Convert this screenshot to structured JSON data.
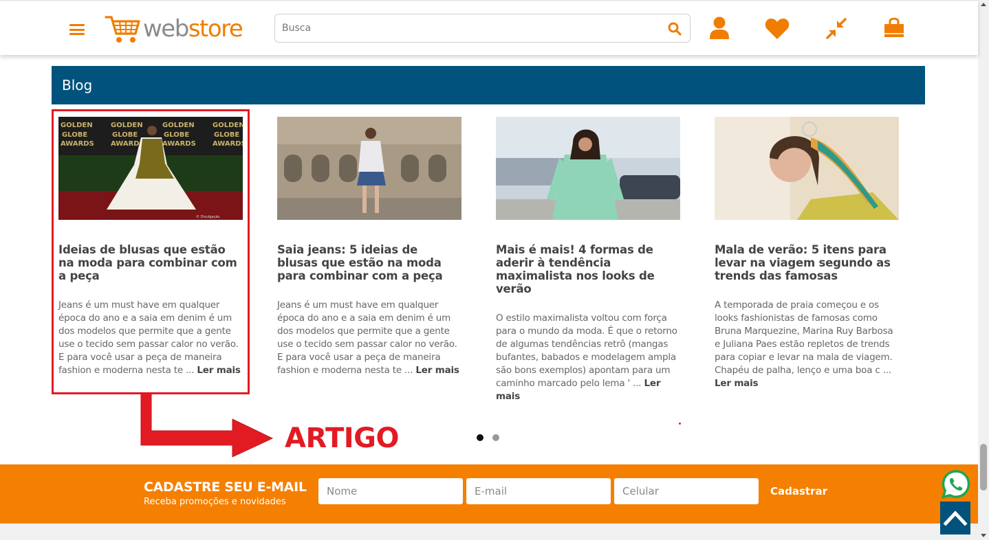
{
  "header": {
    "logo_text_left": "web",
    "logo_text_right": "store",
    "search_placeholder": "Busca",
    "icons": [
      "menu-icon",
      "search-icon",
      "user-icon",
      "heart-icon",
      "compare-icon",
      "shopping-bag-icon"
    ]
  },
  "blog": {
    "title": "Blog",
    "read_more_label": "Ler mais",
    "cards": [
      {
        "title": "Ideias de blusas que estão na moda para combinar com a peça",
        "excerpt": "Jeans é um must have em qualquer época do ano e a saia em denim é um dos modelos que permite que a gente use o tecido sem passar calor no verão. E para você usar a peça de maneira fashion e moderna nesta te ...",
        "image_text": "GOLDEN GLOBE AWARDS"
      },
      {
        "title": "Saia jeans: 5 ideias de blusas que estão na moda para combinar com a peça",
        "excerpt": "Jeans é um must have em qualquer época do ano e a saia em denim é um dos modelos que permite que a gente use o tecido sem passar calor no verão. E para você usar a peça de maneira fashion e moderna nesta te ..."
      },
      {
        "title": "Mais é mais! 4 formas de aderir à tendência maximalista nos looks de verão",
        "excerpt": "O estilo maximalista voltou com força para o mundo da moda. É que o retorno de algumas tendências retrô (mangas bufantes, babados e modelagem ampla são bons exemplos) apontam para um caminho marcado pelo lema ' ..."
      },
      {
        "title": "Mala de verão: 5 itens para levar na viagem segundo as trends das famosas",
        "excerpt": "A temporada de praia começou e os looks fashionistas de famosas como Bruna Marquezine, Marina Ruy Barbosa e Juliana Paes estão repletos de trends para copiar e levar na mala de viagem. Chapéu de palha, lenço e uma boa c ..."
      }
    ],
    "carousel": {
      "pages": 2,
      "active": 1
    }
  },
  "annotation": {
    "label": "ARTIGO",
    "color": "#e21b23"
  },
  "newsletter": {
    "title": "CADASTRE SEU E-MAIL",
    "subtitle": "Receba promoções e novidades",
    "name_placeholder": "Nome",
    "email_placeholder": "E-mail",
    "phone_placeholder": "Celular",
    "submit_label": "Cadastrar"
  },
  "colors": {
    "brand_orange": "#f57f00",
    "brand_blue": "#01527c",
    "annotation_red": "#e21b23"
  }
}
